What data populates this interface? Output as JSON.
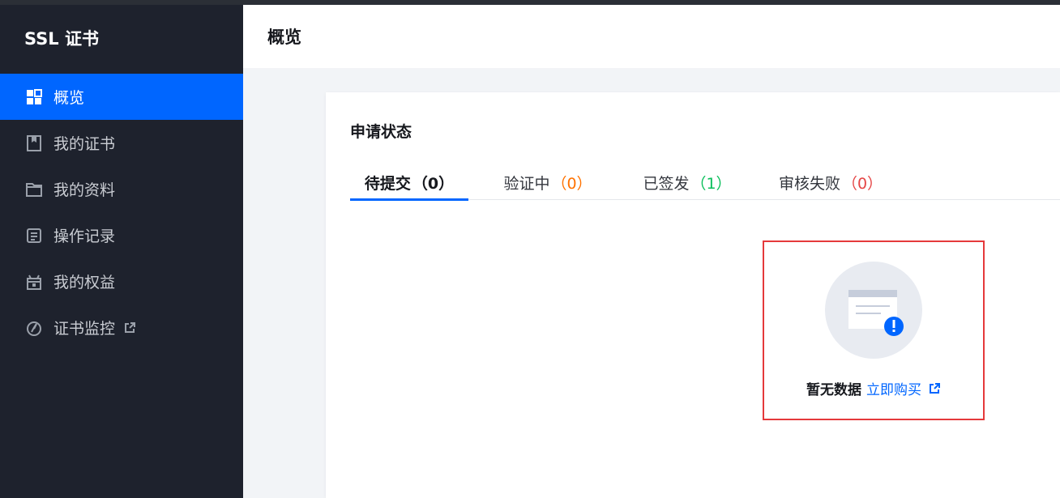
{
  "sidebar": {
    "brand": "SSL 证书",
    "items": [
      {
        "label": "概览",
        "icon": "grid-icon",
        "active": true
      },
      {
        "label": "我的证书",
        "icon": "certificate-icon"
      },
      {
        "label": "我的资料",
        "icon": "folder-icon"
      },
      {
        "label": "操作记录",
        "icon": "record-icon"
      },
      {
        "label": "我的权益",
        "icon": "gift-icon"
      },
      {
        "label": "证书监控",
        "icon": "monitor-icon",
        "external": true
      }
    ]
  },
  "header": {
    "title": "概览"
  },
  "card": {
    "title": "申请状态",
    "tabs": [
      {
        "label": "待提交",
        "count": "（0）",
        "active": true
      },
      {
        "label": "验证中",
        "count": "（0）"
      },
      {
        "label": "已签发",
        "count": "（1）"
      },
      {
        "label": "审核失败",
        "count": "（0）"
      }
    ]
  },
  "empty": {
    "label": "暂无数据",
    "link": "立即购买"
  },
  "colors": {
    "accent": "#0066ff",
    "sidebar_bg": "#1e222d",
    "highlight_border": "#e5393b"
  }
}
